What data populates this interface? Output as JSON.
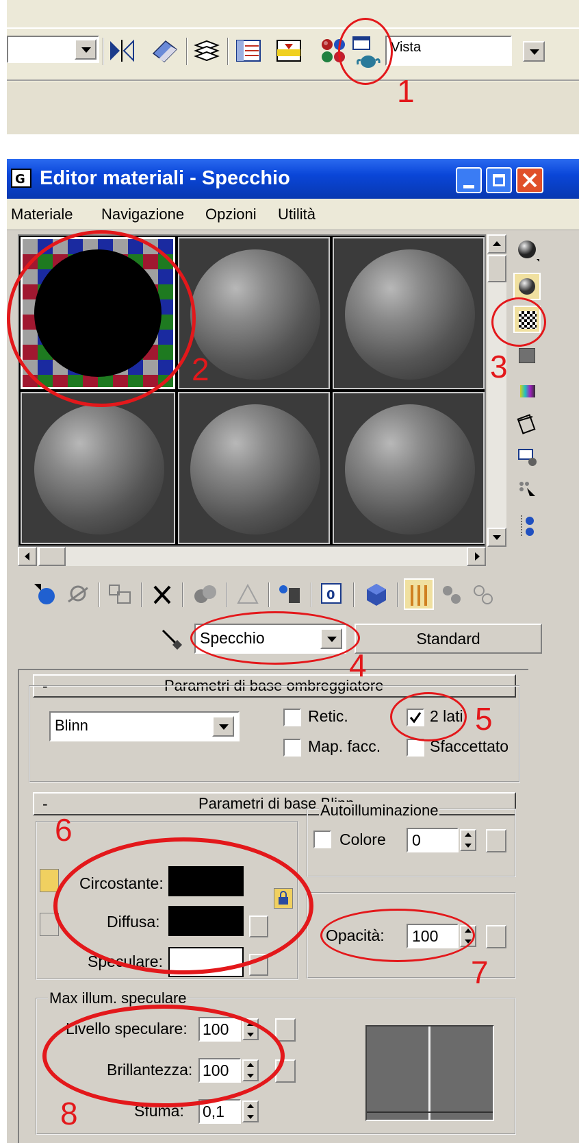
{
  "toolbar": {
    "view_dropdown_value": "Vista",
    "icons": [
      "dropdown-arrow-icon",
      "mirror-icon",
      "eraser-icon",
      "layers-icon",
      "track-view-icon",
      "schematic-view-icon",
      "material-editor-icon",
      "render-setup-icon",
      "render-teapot-icon"
    ]
  },
  "window": {
    "title": "Editor materiali - Specchio",
    "menu": [
      "Materiale",
      "Navigazione",
      "Opzioni",
      "Utilità"
    ]
  },
  "material_bar": {
    "material_name": "Specchio",
    "material_type": "Standard"
  },
  "shader_rollout": {
    "header": "Parametri di base ombreggiatore",
    "collapse": "-",
    "shader": "Blinn",
    "wire_label": "Retic.",
    "two_sided_label": "2 lati",
    "face_map_label": "Map. facc.",
    "faceted_label": "Sfaccettato"
  },
  "blinn_rollout": {
    "header": "Parametri di base Blinn",
    "collapse": "-",
    "ambient_label": "Circostante:",
    "diffuse_label": "Diffusa:",
    "specular_label": "Speculare:",
    "self_illum_group": "Autoilluminazione",
    "self_illum_color_label": "Colore",
    "self_illum_value": "0",
    "opacity_label": "Opacità:",
    "opacity_value": "100",
    "specular_group": "Max illum. speculare",
    "spec_level_label": "Livello speculare:",
    "spec_level_value": "100",
    "glossiness_label": "Brillantezza:",
    "glossiness_value": "100",
    "soften_label": "Sfuma:",
    "soften_value": "0,1"
  },
  "annotations": [
    "1",
    "2",
    "3",
    "4",
    "5",
    "6",
    "7",
    "8"
  ],
  "colors": {
    "annotation_red": "#e3181b",
    "titlebar": "#0a46d8",
    "panel": "#d4d0c8",
    "ambient": "#000000",
    "diffuse": "#000000",
    "specular": "#ffffff"
  }
}
